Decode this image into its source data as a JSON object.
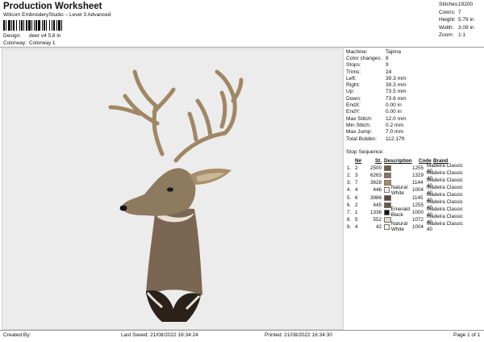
{
  "header": {
    "title": "Production Worksheet",
    "subtitle": "Wilcom EmbroideryStudio – Level 3 Advanced",
    "design_label": "Design:",
    "design_value": "deer v4 5,8 in",
    "colorway_label": "Colorway:",
    "colorway_value": "Colorway 1"
  },
  "stats": [
    {
      "label": "Stitches:",
      "value": "19200"
    },
    {
      "label": "Colors:",
      "value": "7"
    },
    {
      "label": "Height:",
      "value": "5.79 in"
    },
    {
      "label": "Width:",
      "value": "3.09 in"
    },
    {
      "label": "Zoom:",
      "value": "1:1"
    }
  ],
  "info": [
    {
      "label": "Machine:",
      "value": "Tajima"
    },
    {
      "label": "Color changes:",
      "value": "8"
    },
    {
      "label": "Stops:",
      "value": "9"
    },
    {
      "label": "Trims:",
      "value": "24"
    },
    {
      "label": "Left:",
      "value": "39.3 mm"
    },
    {
      "label": "Right:",
      "value": "39.3 mm"
    },
    {
      "label": "Up:",
      "value": "73.5 mm"
    },
    {
      "label": "Down:",
      "value": "73.6 mm"
    },
    {
      "label": "EndX:",
      "value": "0.00 in"
    },
    {
      "label": "EndY:",
      "value": "0.00 in"
    },
    {
      "label": "Max Stitch:",
      "value": "12.0 mm"
    },
    {
      "label": "Min Stitch:",
      "value": "0.2 mm"
    },
    {
      "label": "Max Jump:",
      "value": "7.0 mm"
    },
    {
      "label": "Total Bobbin:",
      "value": "112.17ft"
    }
  ],
  "sequence": {
    "heading": "Stop Sequence:",
    "columns": [
      "N#",
      "St.",
      "Description",
      "Code",
      "Brand"
    ],
    "rows": [
      {
        "stop": "1.",
        "n": "2",
        "st": "2500",
        "color": "#6f5a43",
        "desc": "",
        "code": "1255",
        "brand": "Madeira Classic 40"
      },
      {
        "stop": "2.",
        "n": "3",
        "st": "6263",
        "color": "#8a735a",
        "desc": "",
        "code": "1329",
        "brand": "Madeira Classic 40"
      },
      {
        "stop": "3.",
        "n": "7",
        "st": "3628",
        "color": "#a88a63",
        "desc": "",
        "code": "1144",
        "brand": "Madeira Classic 40"
      },
      {
        "stop": "4.",
        "n": "4",
        "st": "446",
        "color": "#f4f1ea",
        "desc": "Natural White",
        "code": "1004",
        "brand": "Madeira Classic 40"
      },
      {
        "stop": "5.",
        "n": "6",
        "st": "3986",
        "color": "#5e4a3b",
        "desc": "",
        "code": "1145",
        "brand": "Madeira Classic 40"
      },
      {
        "stop": "6.",
        "n": "2",
        "st": "445",
        "color": "#6f5a43",
        "desc": "",
        "code": "1255",
        "brand": "Madeira Classic 40"
      },
      {
        "stop": "7.",
        "n": "1",
        "st": "1336",
        "color": "#141414",
        "desc": "Emerald Black",
        "code": "1000",
        "brand": "Madeira Classic 40"
      },
      {
        "stop": "8.",
        "n": "5",
        "st": "552",
        "color": "#e4d9cc",
        "desc": "",
        "code": "1072",
        "brand": "Madeira Classic 40"
      },
      {
        "stop": "9.",
        "n": "4",
        "st": "42",
        "color": "#f4f1ea",
        "desc": "Natural White",
        "code": "1004",
        "brand": "Madeira Classic 40"
      }
    ]
  },
  "footer": {
    "created_by": "Created By:",
    "last_saved": "Last Saved: 21/08/2022 16:34:24",
    "printed": "Printed: 21/08/2022 16:34:30",
    "page": "Page 1 of 1"
  }
}
